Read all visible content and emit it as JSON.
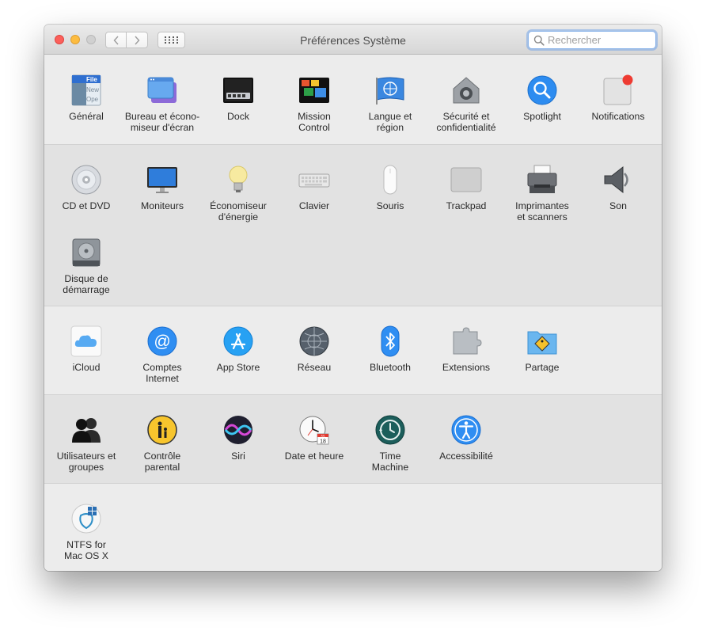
{
  "window": {
    "title": "Préférences Système",
    "search_placeholder": "Rechercher"
  },
  "sections": [
    {
      "items": [
        {
          "label": "Général",
          "icon": "general-icon"
        },
        {
          "label": "Bureau et écono-\nmiseur d'écran",
          "icon": "desktop-screensaver-icon"
        },
        {
          "label": "Dock",
          "icon": "dock-icon"
        },
        {
          "label": "Mission\nControl",
          "icon": "mission-control-icon"
        },
        {
          "label": "Langue et\nrégion",
          "icon": "language-region-icon"
        },
        {
          "label": "Sécurité et\nconfidentialité",
          "icon": "security-icon"
        },
        {
          "label": "Spotlight",
          "icon": "spotlight-icon"
        },
        {
          "label": "Notifications",
          "icon": "notifications-icon"
        }
      ]
    },
    {
      "items": [
        {
          "label": "CD et DVD",
          "icon": "cd-dvd-icon"
        },
        {
          "label": "Moniteurs",
          "icon": "displays-icon"
        },
        {
          "label": "Économiseur\nd'énergie",
          "icon": "energy-saver-icon"
        },
        {
          "label": "Clavier",
          "icon": "keyboard-icon"
        },
        {
          "label": "Souris",
          "icon": "mouse-icon"
        },
        {
          "label": "Trackpad",
          "icon": "trackpad-icon"
        },
        {
          "label": "Imprimantes\net scanners",
          "icon": "printer-icon"
        },
        {
          "label": "Son",
          "icon": "sound-icon"
        },
        {
          "label": "Disque de\ndémarrage",
          "icon": "startup-disk-icon"
        }
      ]
    },
    {
      "items": [
        {
          "label": "iCloud",
          "icon": "icloud-icon"
        },
        {
          "label": "Comptes\nInternet",
          "icon": "internet-accounts-icon"
        },
        {
          "label": "App Store",
          "icon": "app-store-icon"
        },
        {
          "label": "Réseau",
          "icon": "network-icon"
        },
        {
          "label": "Bluetooth",
          "icon": "bluetooth-icon"
        },
        {
          "label": "Extensions",
          "icon": "extensions-icon"
        },
        {
          "label": "Partage",
          "icon": "sharing-icon"
        }
      ]
    },
    {
      "items": [
        {
          "label": "Utilisateurs et\ngroupes",
          "icon": "users-groups-icon"
        },
        {
          "label": "Contrôle\nparental",
          "icon": "parental-controls-icon"
        },
        {
          "label": "Siri",
          "icon": "siri-icon"
        },
        {
          "label": "Date et heure",
          "icon": "date-time-icon"
        },
        {
          "label": "Time\nMachine",
          "icon": "time-machine-icon"
        },
        {
          "label": "Accessibilité",
          "icon": "accessibility-icon"
        }
      ]
    },
    {
      "items": [
        {
          "label": "NTFS for\nMac OS X",
          "icon": "ntfs-icon"
        }
      ]
    }
  ],
  "icon_text": {
    "general": [
      "File",
      "New",
      "Ope"
    ],
    "calendar_month": "JUL",
    "calendar_day": "18"
  }
}
